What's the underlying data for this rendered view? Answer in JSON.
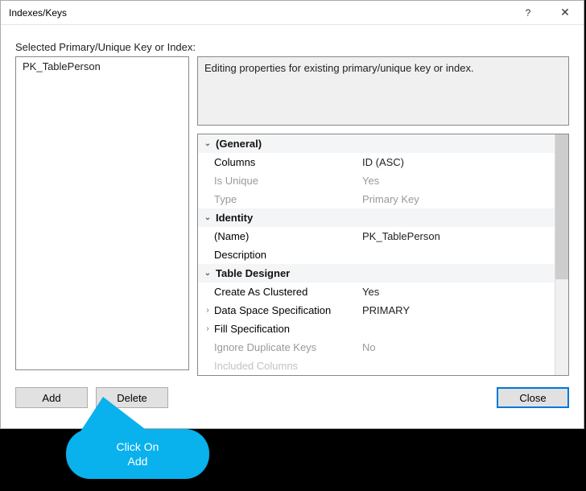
{
  "titlebar": {
    "title": "Indexes/Keys",
    "help": "?",
    "close_glyph": "✕"
  },
  "section_label": "Selected Primary/Unique Key or Index:",
  "index_list": {
    "items": [
      "PK_TablePerson"
    ]
  },
  "description": "Editing properties for existing primary/unique key or index.",
  "groups": {
    "general": {
      "label": "(General)",
      "columns": {
        "label": "Columns",
        "value": "ID (ASC)"
      },
      "is_unique": {
        "label": "Is Unique",
        "value": "Yes"
      },
      "type": {
        "label": "Type",
        "value": "Primary Key"
      }
    },
    "identity": {
      "label": "Identity",
      "name": {
        "label": "(Name)",
        "value": "PK_TablePerson"
      },
      "description": {
        "label": "Description",
        "value": ""
      }
    },
    "designer": {
      "label": "Table Designer",
      "create_as_clustered": {
        "label": "Create As Clustered",
        "value": "Yes"
      },
      "data_space_spec": {
        "label": "Data Space Specification",
        "value": "PRIMARY"
      },
      "fill_spec": {
        "label": "Fill Specification",
        "value": ""
      },
      "ignore_dup": {
        "label": "Ignore Duplicate Keys",
        "value": "No"
      },
      "included_cols": {
        "label": "Included Columns",
        "value": ""
      }
    }
  },
  "buttons": {
    "add": "Add",
    "delete": "Delete",
    "close": "Close"
  },
  "annotation": {
    "text": "Click On\nAdd"
  }
}
